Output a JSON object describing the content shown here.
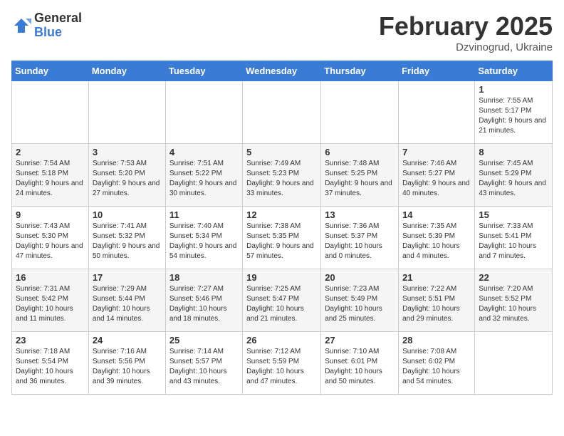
{
  "header": {
    "logo_general": "General",
    "logo_blue": "Blue",
    "month_title": "February 2025",
    "location": "Dzvinogrud, Ukraine"
  },
  "weekdays": [
    "Sunday",
    "Monday",
    "Tuesday",
    "Wednesday",
    "Thursday",
    "Friday",
    "Saturday"
  ],
  "weeks": [
    [
      {
        "day": "",
        "info": ""
      },
      {
        "day": "",
        "info": ""
      },
      {
        "day": "",
        "info": ""
      },
      {
        "day": "",
        "info": ""
      },
      {
        "day": "",
        "info": ""
      },
      {
        "day": "",
        "info": ""
      },
      {
        "day": "1",
        "info": "Sunrise: 7:55 AM\nSunset: 5:17 PM\nDaylight: 9 hours and 21 minutes."
      }
    ],
    [
      {
        "day": "2",
        "info": "Sunrise: 7:54 AM\nSunset: 5:18 PM\nDaylight: 9 hours and 24 minutes."
      },
      {
        "day": "3",
        "info": "Sunrise: 7:53 AM\nSunset: 5:20 PM\nDaylight: 9 hours and 27 minutes."
      },
      {
        "day": "4",
        "info": "Sunrise: 7:51 AM\nSunset: 5:22 PM\nDaylight: 9 hours and 30 minutes."
      },
      {
        "day": "5",
        "info": "Sunrise: 7:49 AM\nSunset: 5:23 PM\nDaylight: 9 hours and 33 minutes."
      },
      {
        "day": "6",
        "info": "Sunrise: 7:48 AM\nSunset: 5:25 PM\nDaylight: 9 hours and 37 minutes."
      },
      {
        "day": "7",
        "info": "Sunrise: 7:46 AM\nSunset: 5:27 PM\nDaylight: 9 hours and 40 minutes."
      },
      {
        "day": "8",
        "info": "Sunrise: 7:45 AM\nSunset: 5:29 PM\nDaylight: 9 hours and 43 minutes."
      }
    ],
    [
      {
        "day": "9",
        "info": "Sunrise: 7:43 AM\nSunset: 5:30 PM\nDaylight: 9 hours and 47 minutes."
      },
      {
        "day": "10",
        "info": "Sunrise: 7:41 AM\nSunset: 5:32 PM\nDaylight: 9 hours and 50 minutes."
      },
      {
        "day": "11",
        "info": "Sunrise: 7:40 AM\nSunset: 5:34 PM\nDaylight: 9 hours and 54 minutes."
      },
      {
        "day": "12",
        "info": "Sunrise: 7:38 AM\nSunset: 5:35 PM\nDaylight: 9 hours and 57 minutes."
      },
      {
        "day": "13",
        "info": "Sunrise: 7:36 AM\nSunset: 5:37 PM\nDaylight: 10 hours and 0 minutes."
      },
      {
        "day": "14",
        "info": "Sunrise: 7:35 AM\nSunset: 5:39 PM\nDaylight: 10 hours and 4 minutes."
      },
      {
        "day": "15",
        "info": "Sunrise: 7:33 AM\nSunset: 5:41 PM\nDaylight: 10 hours and 7 minutes."
      }
    ],
    [
      {
        "day": "16",
        "info": "Sunrise: 7:31 AM\nSunset: 5:42 PM\nDaylight: 10 hours and 11 minutes."
      },
      {
        "day": "17",
        "info": "Sunrise: 7:29 AM\nSunset: 5:44 PM\nDaylight: 10 hours and 14 minutes."
      },
      {
        "day": "18",
        "info": "Sunrise: 7:27 AM\nSunset: 5:46 PM\nDaylight: 10 hours and 18 minutes."
      },
      {
        "day": "19",
        "info": "Sunrise: 7:25 AM\nSunset: 5:47 PM\nDaylight: 10 hours and 21 minutes."
      },
      {
        "day": "20",
        "info": "Sunrise: 7:23 AM\nSunset: 5:49 PM\nDaylight: 10 hours and 25 minutes."
      },
      {
        "day": "21",
        "info": "Sunrise: 7:22 AM\nSunset: 5:51 PM\nDaylight: 10 hours and 29 minutes."
      },
      {
        "day": "22",
        "info": "Sunrise: 7:20 AM\nSunset: 5:52 PM\nDaylight: 10 hours and 32 minutes."
      }
    ],
    [
      {
        "day": "23",
        "info": "Sunrise: 7:18 AM\nSunset: 5:54 PM\nDaylight: 10 hours and 36 minutes."
      },
      {
        "day": "24",
        "info": "Sunrise: 7:16 AM\nSunset: 5:56 PM\nDaylight: 10 hours and 39 minutes."
      },
      {
        "day": "25",
        "info": "Sunrise: 7:14 AM\nSunset: 5:57 PM\nDaylight: 10 hours and 43 minutes."
      },
      {
        "day": "26",
        "info": "Sunrise: 7:12 AM\nSunset: 5:59 PM\nDaylight: 10 hours and 47 minutes."
      },
      {
        "day": "27",
        "info": "Sunrise: 7:10 AM\nSunset: 6:01 PM\nDaylight: 10 hours and 50 minutes."
      },
      {
        "day": "28",
        "info": "Sunrise: 7:08 AM\nSunset: 6:02 PM\nDaylight: 10 hours and 54 minutes."
      },
      {
        "day": "",
        "info": ""
      }
    ]
  ]
}
